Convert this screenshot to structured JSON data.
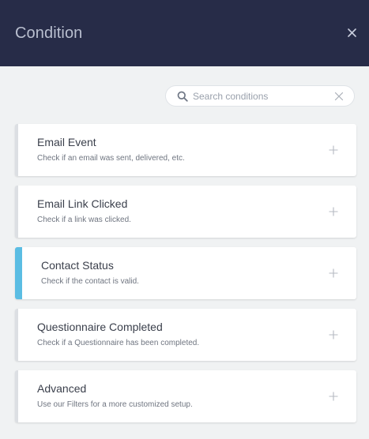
{
  "header": {
    "title": "Condition",
    "close_icon": "close-icon"
  },
  "search": {
    "placeholder": "Search conditions",
    "value": "",
    "search_icon": "search-icon",
    "clear_icon": "clear-icon"
  },
  "colors": {
    "header_bg": "#272c48",
    "header_text": "#b9bfcf",
    "page_bg": "#f0f2f3",
    "active_accent": "#5bbde3"
  },
  "conditions": [
    {
      "title": "Email Event",
      "description": "Check if an email was sent, delivered, etc.",
      "active": false
    },
    {
      "title": "Email Link Clicked",
      "description": "Check if a link was clicked.",
      "active": false
    },
    {
      "title": "Contact Status",
      "description": "Check if the contact is valid.",
      "active": true
    },
    {
      "title": "Questionnaire Completed",
      "description": "Check if a Questionnaire has been completed.",
      "active": false
    },
    {
      "title": "Advanced",
      "description": "Use our Filters for a more customized setup.",
      "active": false
    }
  ],
  "add_icon": "plus-icon"
}
